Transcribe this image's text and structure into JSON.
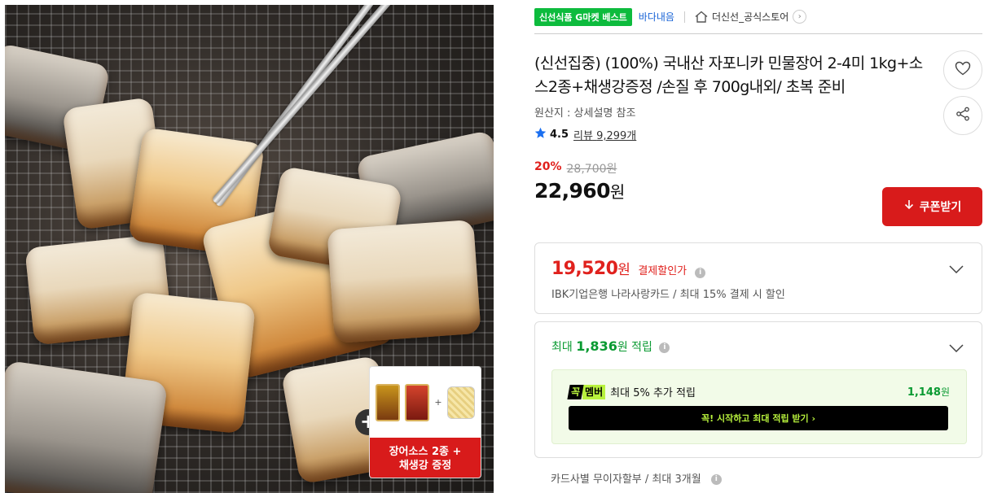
{
  "breadcrumb": {
    "badge": "신선식품 G마켓 베스트",
    "category": "바다내음",
    "store": "더신선_공식스토어"
  },
  "product": {
    "title": "(신선집중) (100%) 국내산 자포니카 민물장어 2-4미 1kg+소스2종+채생강증정 /손질 후 700g내외/ 초복 준비",
    "origin": "원산지 : 상세설명 참조",
    "rating": "4.5",
    "review_label": "리뷰",
    "review_count": "9,299개"
  },
  "pricing": {
    "discount_pct": "20%",
    "original_price": "28,700원",
    "price": "22,960",
    "currency": "원",
    "coupon_button": "쿠폰받기"
  },
  "payment_discount": {
    "price": "19,520",
    "currency": "원",
    "label": "결제할인가",
    "description": "IBK기업은행 나라사랑카드 / 최대 15% 결제 시 할인"
  },
  "points": {
    "prefix": "최대",
    "amount": "1,836",
    "suffix": "원 적립",
    "club_k": "꼭",
    "club_m": "멤버",
    "club_text": "최대 5% 추가 적립",
    "club_amount": "1,148",
    "club_currency": "원",
    "join_button": "꼭! 시작하고 최대 적립 받기 ›"
  },
  "installment": "카드사별 무이자할부 / 최대 3개월",
  "promo": {
    "label": "장어소스 2종 +\n채생강 증정",
    "plus_symbol": "+",
    "small_plus": "+"
  },
  "icons": {
    "info": "i",
    "chev_right": "›"
  },
  "colors": {
    "brand_green": "#0dbb3d",
    "price_red": "#e0211d",
    "coupon_red": "#d81b1b",
    "link_blue": "#1863d6",
    "club_lime": "#b8f23d"
  }
}
